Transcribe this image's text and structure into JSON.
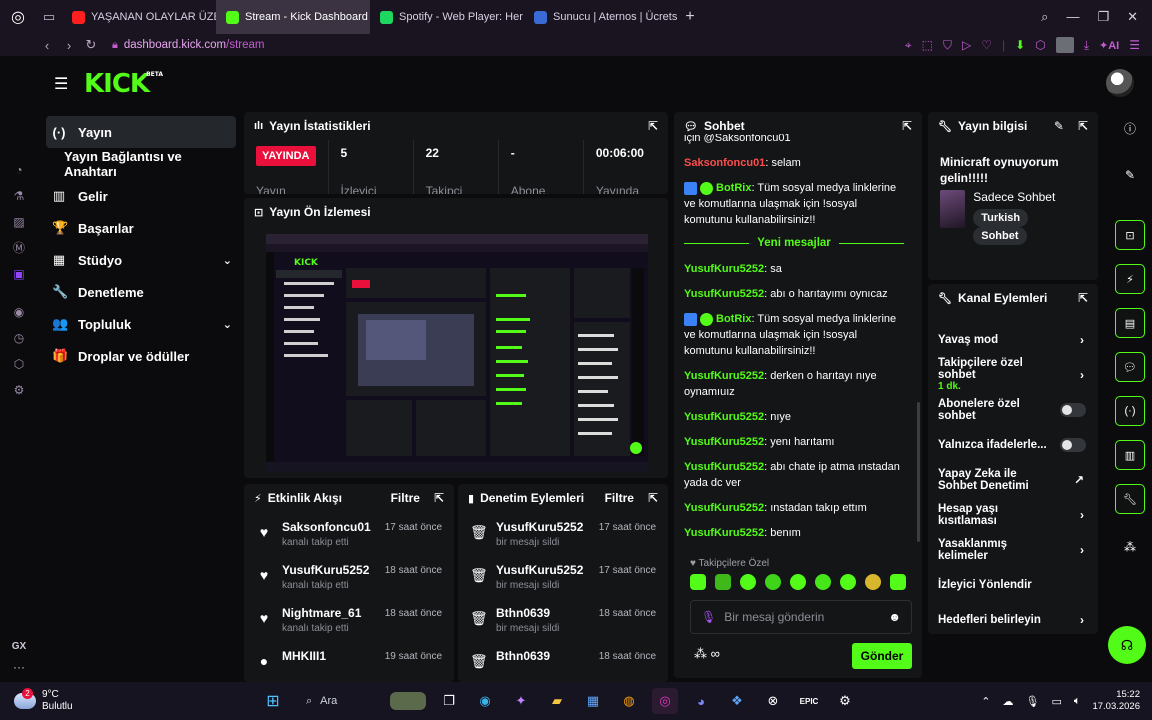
{
  "browser": {
    "tabs": [
      {
        "label": "YAŞANAN OLAYLAR ÜZER",
        "color": "#ff1f1f",
        "active": false
      },
      {
        "label": "Stream - Kick Dashboard",
        "color": "#53fc18",
        "active": true
      },
      {
        "label": "Spotify - Web Player: Her",
        "color": "#1ed760",
        "active": false
      },
      {
        "label": "Sunucu | Aternos | Ücretsi",
        "color": "#3a6ad6",
        "active": false
      }
    ],
    "url_host": "dashboard.kick.com",
    "url_path": "/stream",
    "ai_label": "AI"
  },
  "kick": {
    "logo": "KICK",
    "beta": "BETA",
    "nav": [
      {
        "label": "Yayın",
        "icon": "stream-icon",
        "glyph": "(·)",
        "active": true,
        "sub": false,
        "chevron": false
      },
      {
        "label": "Yayın Bağlantısı ve Anahtarı",
        "icon": "",
        "glyph": "",
        "active": false,
        "sub": true,
        "chevron": false
      },
      {
        "label": "Gelir",
        "icon": "chart-icon",
        "glyph": "▥",
        "active": false,
        "sub": false,
        "chevron": false
      },
      {
        "label": "Başarılar",
        "icon": "trophy-icon",
        "glyph": "🏆",
        "active": false,
        "sub": false,
        "chevron": false
      },
      {
        "label": "Stüdyo",
        "icon": "studio-icon",
        "glyph": "▦",
        "active": false,
        "sub": false,
        "chevron": true
      },
      {
        "label": "Denetleme",
        "icon": "wrench-icon",
        "glyph": "🔧",
        "active": false,
        "sub": false,
        "chevron": false
      },
      {
        "label": "Topluluk",
        "icon": "community-icon",
        "glyph": "👥",
        "active": false,
        "sub": false,
        "chevron": true
      },
      {
        "label": "Droplar ve ödüller",
        "icon": "gift-icon",
        "glyph": "🎁",
        "active": false,
        "sub": false,
        "chevron": false
      }
    ],
    "stats": {
      "title": "Yayın İstatistikleri",
      "live_label": "YAYINDA",
      "live_sub": "Yayın",
      "items": [
        {
          "value": "5",
          "label": "İzleyici"
        },
        {
          "value": "22",
          "label": "Takipçi"
        },
        {
          "value": "-",
          "label": "Abone"
        },
        {
          "value": "00:06:00",
          "label": "Yayında"
        }
      ]
    },
    "preview": {
      "title": "Yayın Ön İzlemesi"
    },
    "activity": {
      "title": "Etkinlik Akışı",
      "filter": "Filtre",
      "items": [
        {
          "name": "Saksonfoncu01",
          "sub": "kanalı takip etti",
          "time": "17 saat önce",
          "glyph": "♥"
        },
        {
          "name": "YusufKuru5252",
          "sub": "kanalı takip etti",
          "time": "18 saat önce",
          "glyph": "♥"
        },
        {
          "name": "Nightmare_61",
          "sub": "kanalı takip etti",
          "time": "18 saat önce",
          "glyph": "♥"
        },
        {
          "name": "MHKIII1",
          "sub": "",
          "time": "19 saat önce",
          "glyph": "●"
        }
      ]
    },
    "moderation": {
      "title": "Denetim Eylemleri",
      "filter": "Filtre",
      "items": [
        {
          "name": "YusufKuru5252",
          "sub": "bir mesajı sildi",
          "time": "17 saat önce"
        },
        {
          "name": "YusufKuru5252",
          "sub": "bir mesajı sildi",
          "time": "17 saat önce"
        },
        {
          "name": "Bthn0639",
          "sub": "bir mesajı sildi",
          "time": "18 saat önce"
        },
        {
          "name": "Bthn0639",
          "sub": "",
          "time": "18 saat önce"
        }
      ]
    },
    "chat": {
      "title": "Sohbet",
      "top_fragment": "için @Saksonfoncu01",
      "messages_before": [
        {
          "user": "Saksonfoncu01",
          "text": "selam",
          "color": "red",
          "bot": false
        },
        {
          "user": "BotRix",
          "text": "Tüm sosyal medya linklerine ve komutlarına ulaşmak için !sosyal komutunu kullanabilirsiniz!!",
          "color": "green",
          "bot": true
        }
      ],
      "new_messages_label": "Yeni mesajlar",
      "messages_after": [
        {
          "user": "YusufKuru5252",
          "text": "sa",
          "color": "green",
          "bot": false
        },
        {
          "user": "YusufKuru5252",
          "text": "abı o harıtayımı oynıcaz",
          "color": "green",
          "bot": false
        },
        {
          "user": "BotRix",
          "text": "Tüm sosyal medya linklerine ve komutlarına ulaşmak için !sosyal komutunu kullanabilirsiniz!!",
          "color": "green",
          "bot": true
        },
        {
          "user": "YusufKuru5252",
          "text": "derken o harıtayı nıye oynamıuız",
          "color": "green",
          "bot": false
        },
        {
          "user": "YusufKuru5252",
          "text": "nıye",
          "color": "green",
          "bot": false
        },
        {
          "user": "YusufKuru5252",
          "text": "yenı harıtamı",
          "color": "green",
          "bot": false
        },
        {
          "user": "YusufKuru5252",
          "text": "abı chate ip atma ınstadan yada dc ver",
          "color": "green",
          "bot": false
        },
        {
          "user": "YusufKuru5252",
          "text": "ınstadan takıp ettım",
          "color": "green",
          "bot": false
        },
        {
          "user": "YusufKuru5252",
          "text": "benım",
          "color": "green",
          "bot": false
        }
      ],
      "followers_only": "Takipçilere Özel",
      "input_placeholder": "Bir mesaj gönderin",
      "send_label": "Gönder"
    },
    "stream_info": {
      "title": "Yayın bilgisi",
      "stream_title": "Minicraft oynuyorum gelin!!!!!",
      "category": "Sadece Sohbet",
      "tags": [
        "Turkish",
        "Sohbet"
      ]
    },
    "channel_actions": {
      "title": "Kanal Eylemleri",
      "items": [
        {
          "label": "Yavaş mod",
          "sub": "",
          "control": "arrow"
        },
        {
          "label": "Takipçilere özel sohbet",
          "sub": "1 dk.",
          "control": "arrow"
        },
        {
          "label": "Abonelere özel sohbet",
          "sub": "",
          "control": "toggle"
        },
        {
          "label": "Yalnızca ifadelerle...",
          "sub": "",
          "control": "toggle"
        },
        {
          "label": "Yapay Zeka ile Sohbet Denetimi",
          "sub": "",
          "control": "external"
        },
        {
          "label": "Hesap yaşı kısıtlaması",
          "sub": "",
          "control": "arrow"
        },
        {
          "label": "Yasaklanmış kelimeler",
          "sub": "",
          "control": "arrow"
        },
        {
          "label": "İzleyici Yönlendir",
          "sub": "",
          "control": "none"
        },
        {
          "label": "Hedefleri belirleyin",
          "sub": "",
          "control": "arrow"
        }
      ]
    }
  },
  "opera": {
    "gx_label": "GX"
  },
  "taskbar": {
    "temp": "9°C",
    "weather": "Bulutlu",
    "weather_badge": "2",
    "search_label": "Ara",
    "time": "15:22",
    "date": "17.03.2026"
  },
  "colors": {
    "kick_green": "#53fc18",
    "live_red": "#e9113c",
    "opera_accent": "#c25ed0"
  }
}
